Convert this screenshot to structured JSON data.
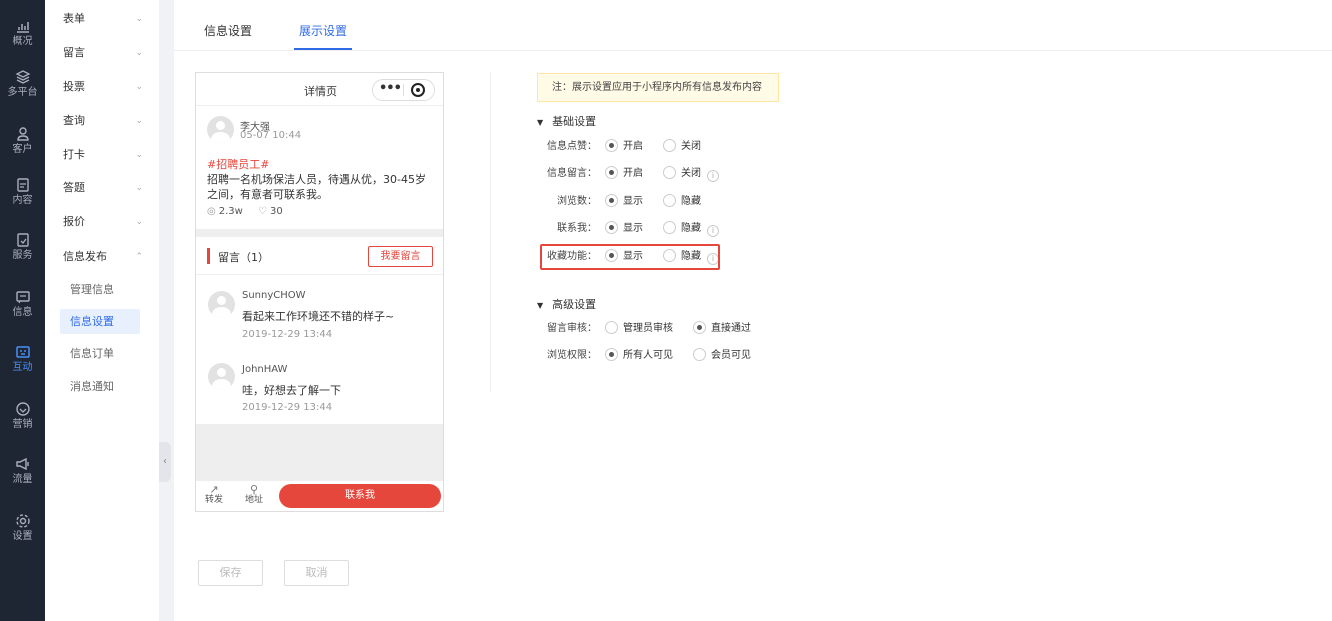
{
  "rail": [
    {
      "label": "概况",
      "icon": "chart-icon"
    },
    {
      "label": "多平台",
      "icon": "layers-icon"
    },
    {
      "label": "客户",
      "icon": "user-icon"
    },
    {
      "label": "内容",
      "icon": "document-icon"
    },
    {
      "label": "服务",
      "icon": "service-icon"
    },
    {
      "label": "信息",
      "icon": "message-icon"
    },
    {
      "label": "互动",
      "icon": "interact-icon",
      "active": true
    },
    {
      "label": "营销",
      "icon": "tag-icon"
    },
    {
      "label": "流量",
      "icon": "megaphone-icon"
    },
    {
      "label": "设置",
      "icon": "gear-icon"
    }
  ],
  "submenu": {
    "items": [
      "表单",
      "留言",
      "投票",
      "查询",
      "打卡",
      "答题",
      "报价",
      "信息发布"
    ],
    "sub_items": [
      "管理信息",
      "信息设置",
      "信息订单",
      "消息通知"
    ],
    "active_sub": "信息设置"
  },
  "tabs": {
    "info": "信息设置",
    "display": "展示设置",
    "active": "展示设置"
  },
  "preview": {
    "page_title": "详情页",
    "capsule_more": "•••",
    "author": "李大强",
    "post_time": "05-07 10:44",
    "tag": "#招聘员工#",
    "body": "招聘一名机场保洁人员，待遇从优，30-45岁之间，有意者可联系我。",
    "views": "2.3w",
    "likes": "30",
    "comments_title": "留言（1）",
    "comment_button": "我要留言",
    "comments": [
      {
        "name": "SunnyCHOW",
        "text": "看起来工作环境还不错的样子~",
        "time": "2019-12-29 13:44"
      },
      {
        "name": "JohnHAW",
        "text": "哇，好想去了解一下",
        "time": "2019-12-29 13:44"
      }
    ],
    "forward_label": "转发",
    "address_label": "地址",
    "contact_button": "联系我"
  },
  "settings": {
    "notice": "注：展示设置应用于小程序内所有信息发布内容",
    "basic_title": "基础设置",
    "advanced_title": "高级设置",
    "basic_rows": [
      {
        "label": "信息点赞：",
        "opt1": "开启",
        "opt2": "关闭",
        "selected": 1,
        "info": false
      },
      {
        "label": "信息留言：",
        "opt1": "开启",
        "opt2": "关闭",
        "selected": 1,
        "info": true
      },
      {
        "label": "浏览数：",
        "opt1": "显示",
        "opt2": "隐藏",
        "selected": 1,
        "info": false
      },
      {
        "label": "联系我：",
        "opt1": "显示",
        "opt2": "隐藏",
        "selected": 1,
        "info": true
      },
      {
        "label": "收藏功能：",
        "opt1": "显示",
        "opt2": "隐藏",
        "selected": 1,
        "info": true
      }
    ],
    "advanced_rows": [
      {
        "label": "留言审核：",
        "opt1": "管理员审核",
        "opt2": "直接通过",
        "selected": 2
      },
      {
        "label": "浏览权限：",
        "opt1": "所有人可见",
        "opt2": "会员可见",
        "selected": 1
      }
    ],
    "info_glyph": "i",
    "save_label": "保存",
    "cancel_label": "取消"
  },
  "colors": {
    "accent": "#2f6be5",
    "danger": "#e5473d",
    "rail_bg": "#1f2633"
  }
}
